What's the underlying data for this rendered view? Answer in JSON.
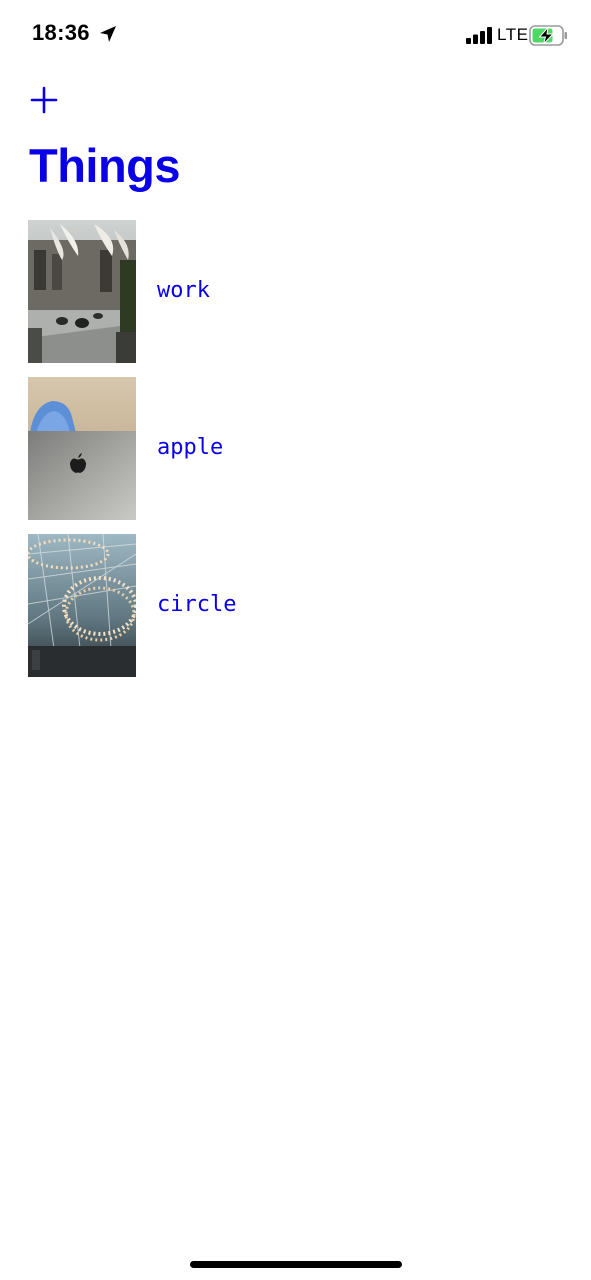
{
  "status_bar": {
    "time": "18:36",
    "network": "LTE",
    "icons": {
      "location": "location-arrow-icon",
      "signal": "cellular-signal-icon",
      "battery": "battery-charging-icon"
    },
    "battery_color": "#4cd964"
  },
  "header": {
    "add_icon": "plus-icon",
    "title": "Things"
  },
  "things": [
    {
      "label": "work",
      "thumbnail": "photo of office lobby with chandeliers"
    },
    {
      "label": "apple",
      "thumbnail": "photo of laptop lid with apple logo"
    },
    {
      "label": "circle",
      "thumbnail": "photo of circular light fixture"
    }
  ],
  "colors": {
    "accent": "#0a00e8",
    "background": "#ffffff"
  }
}
